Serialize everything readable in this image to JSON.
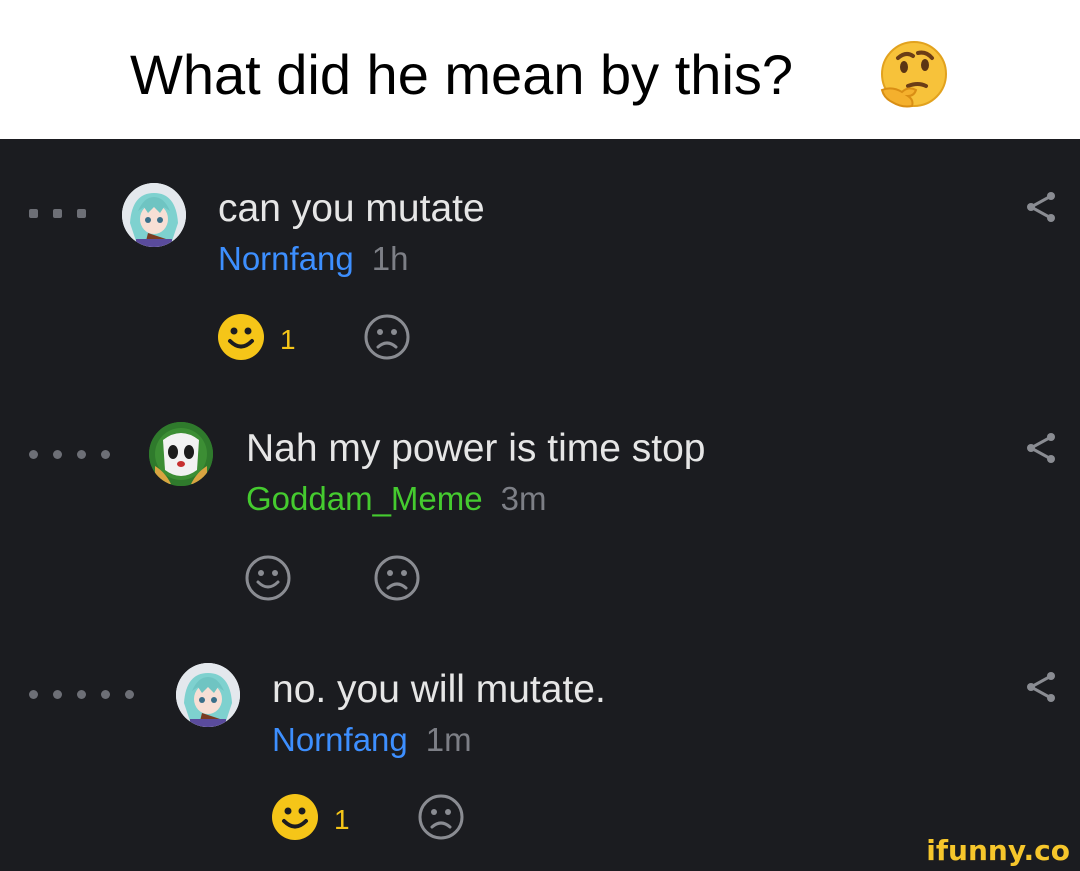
{
  "caption": {
    "text": "What did he mean by this?",
    "emoji_icon": "thinking-face-emoji"
  },
  "comments": [
    {
      "text": "can you mutate",
      "username": "Nornfang",
      "username_color": "#3d8fff",
      "time": "1h",
      "smile_count": "1",
      "smile_active": true,
      "avatar_icon": "anime-girl-avatar"
    },
    {
      "text": "Nah my power is time stop",
      "username": "Goddam_Meme",
      "username_color": "#45cb2f",
      "time": "3m",
      "smile_count": "",
      "smile_active": false,
      "avatar_icon": "panda-avatar"
    },
    {
      "text": "no. you will mutate.",
      "username": "Nornfang",
      "username_color": "#3d8fff",
      "time": "1m",
      "smile_count": "1",
      "smile_active": true,
      "avatar_icon": "anime-girl-avatar"
    }
  ],
  "watermark": "ifunny.co",
  "colors": {
    "background": "#1b1c20",
    "smile_active": "#f5c518",
    "icon_inactive": "#8a8c92"
  }
}
